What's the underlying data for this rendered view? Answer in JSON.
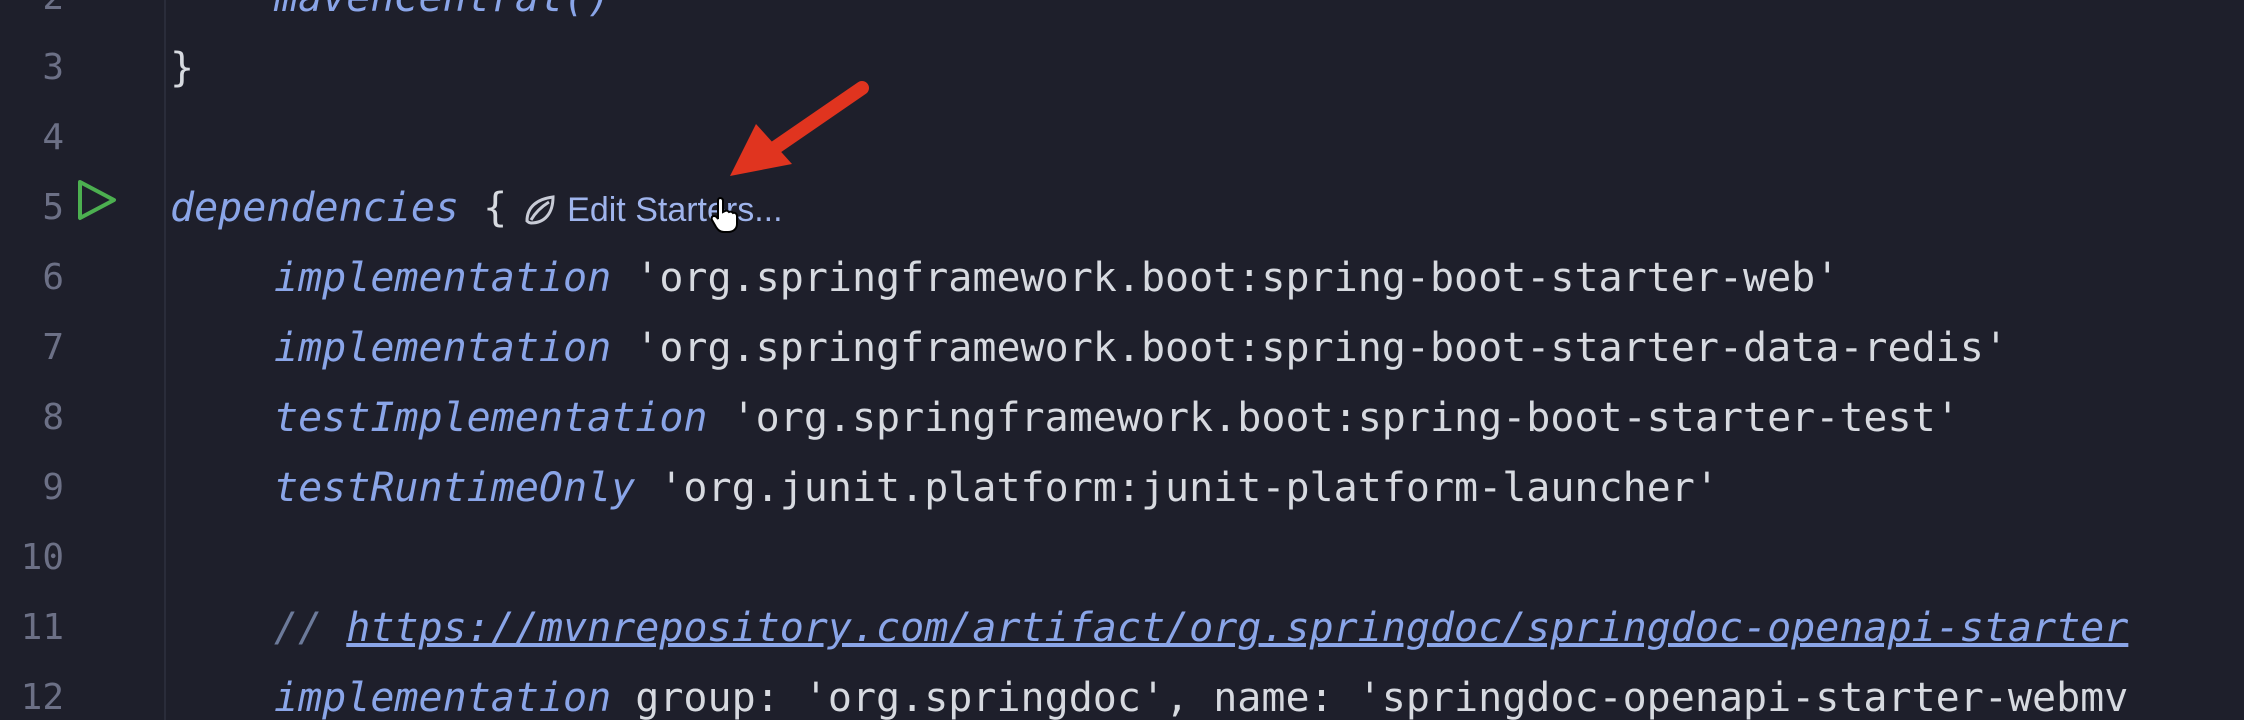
{
  "editor": {
    "lines": [
      {
        "num": "2",
        "parts": [
          {
            "cls": "indent"
          },
          {
            "cls": "kw",
            "text": "mavenCentral()"
          }
        ]
      },
      {
        "num": "3",
        "parts": [
          {
            "cls": "brace",
            "text": "}"
          }
        ]
      },
      {
        "num": "4",
        "parts": []
      },
      {
        "num": "5",
        "parts": [
          {
            "cls": "kw",
            "text": "dependencies"
          },
          {
            "cls": "punc",
            "text": " {"
          }
        ]
      },
      {
        "num": "6",
        "parts": [
          {
            "cls": "indent"
          },
          {
            "cls": "kw",
            "text": "implementation"
          },
          {
            "cls": "str",
            "text": " 'org.springframework.boot:spring-boot-starter-web'"
          }
        ]
      },
      {
        "num": "7",
        "parts": [
          {
            "cls": "indent"
          },
          {
            "cls": "kw",
            "text": "implementation"
          },
          {
            "cls": "str",
            "text": " 'org.springframework.boot:spring-boot-starter-data-redis'"
          }
        ]
      },
      {
        "num": "8",
        "parts": [
          {
            "cls": "indent"
          },
          {
            "cls": "kw",
            "text": "testImplementation"
          },
          {
            "cls": "str",
            "text": " 'org.springframework.boot:spring-boot-starter-test'"
          }
        ]
      },
      {
        "num": "9",
        "parts": [
          {
            "cls": "indent"
          },
          {
            "cls": "kw",
            "text": "testRuntimeOnly"
          },
          {
            "cls": "str",
            "text": " 'org.junit.platform:junit-platform-launcher'"
          }
        ]
      },
      {
        "num": "10",
        "parts": []
      },
      {
        "num": "11",
        "parts": [
          {
            "cls": "indent"
          },
          {
            "cls": "comment",
            "text": "// "
          },
          {
            "cls": "link",
            "text": "https://mvnrepository.com/artifact/org.springdoc/springdoc-openapi-starter"
          }
        ]
      },
      {
        "num": "12",
        "parts": [
          {
            "cls": "indent"
          },
          {
            "cls": "kw",
            "text": "implementation"
          },
          {
            "cls": "str",
            "text": " group: 'org.springdoc', name: 'springdoc-openapi-starter-webmv"
          }
        ]
      }
    ],
    "code_lens_label": "Edit Starters...",
    "code_lens_line": 5
  },
  "colors": {
    "background": "#1e1f2b",
    "keyword": "#8aa5e8",
    "arrow": "#e0341f",
    "run_icon": "#4caf50"
  },
  "icons": {
    "run": "run-play-icon",
    "spring": "spring-leaf-icon",
    "cursor": "hand-pointer-icon",
    "annotation": "red-arrow-icon"
  }
}
